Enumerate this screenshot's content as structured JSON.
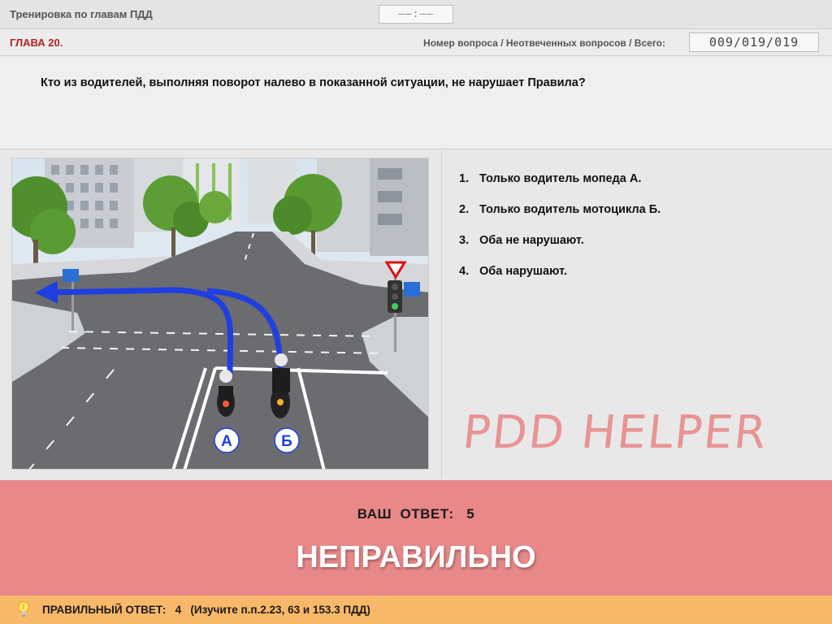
{
  "topbar": {
    "title": "Тренировка по главам ПДД",
    "timer": "——:——"
  },
  "chapterbar": {
    "chapter": "ГЛАВА 20.",
    "counter_label": "Номер вопроса / Неотвеченных вопросов / Всего:",
    "counter": "009/019/019"
  },
  "question": {
    "text": "Кто из водителей, выполняя поворот налево в показанной ситуации, не нарушает Правила?"
  },
  "image": {
    "label_a": "А",
    "label_b": "Б"
  },
  "answers": [
    {
      "num": "1.",
      "text": "Только водитель мопеда А."
    },
    {
      "num": "2.",
      "text": "Только водитель мотоцикла Б."
    },
    {
      "num": "3.",
      "text": "Оба не нарушают."
    },
    {
      "num": "4.",
      "text": "Оба нарушают."
    }
  ],
  "watermark": "PDD HELPER",
  "result": {
    "your_answer": "ВАШ  ОТВЕТ:   5",
    "verdict": "НЕПРАВИЛЬНО"
  },
  "footer": {
    "text": "ПРАВИЛЬНЫЙ ОТВЕТ:   4   (Изучите п.п.2.23, 63 и 153.3 ПДД)"
  },
  "colors": {
    "result_bg": "#e88888",
    "footer_bg": "#f9b869",
    "chapter_red": "#b22222",
    "arrow_blue": "#1f3fe0"
  }
}
